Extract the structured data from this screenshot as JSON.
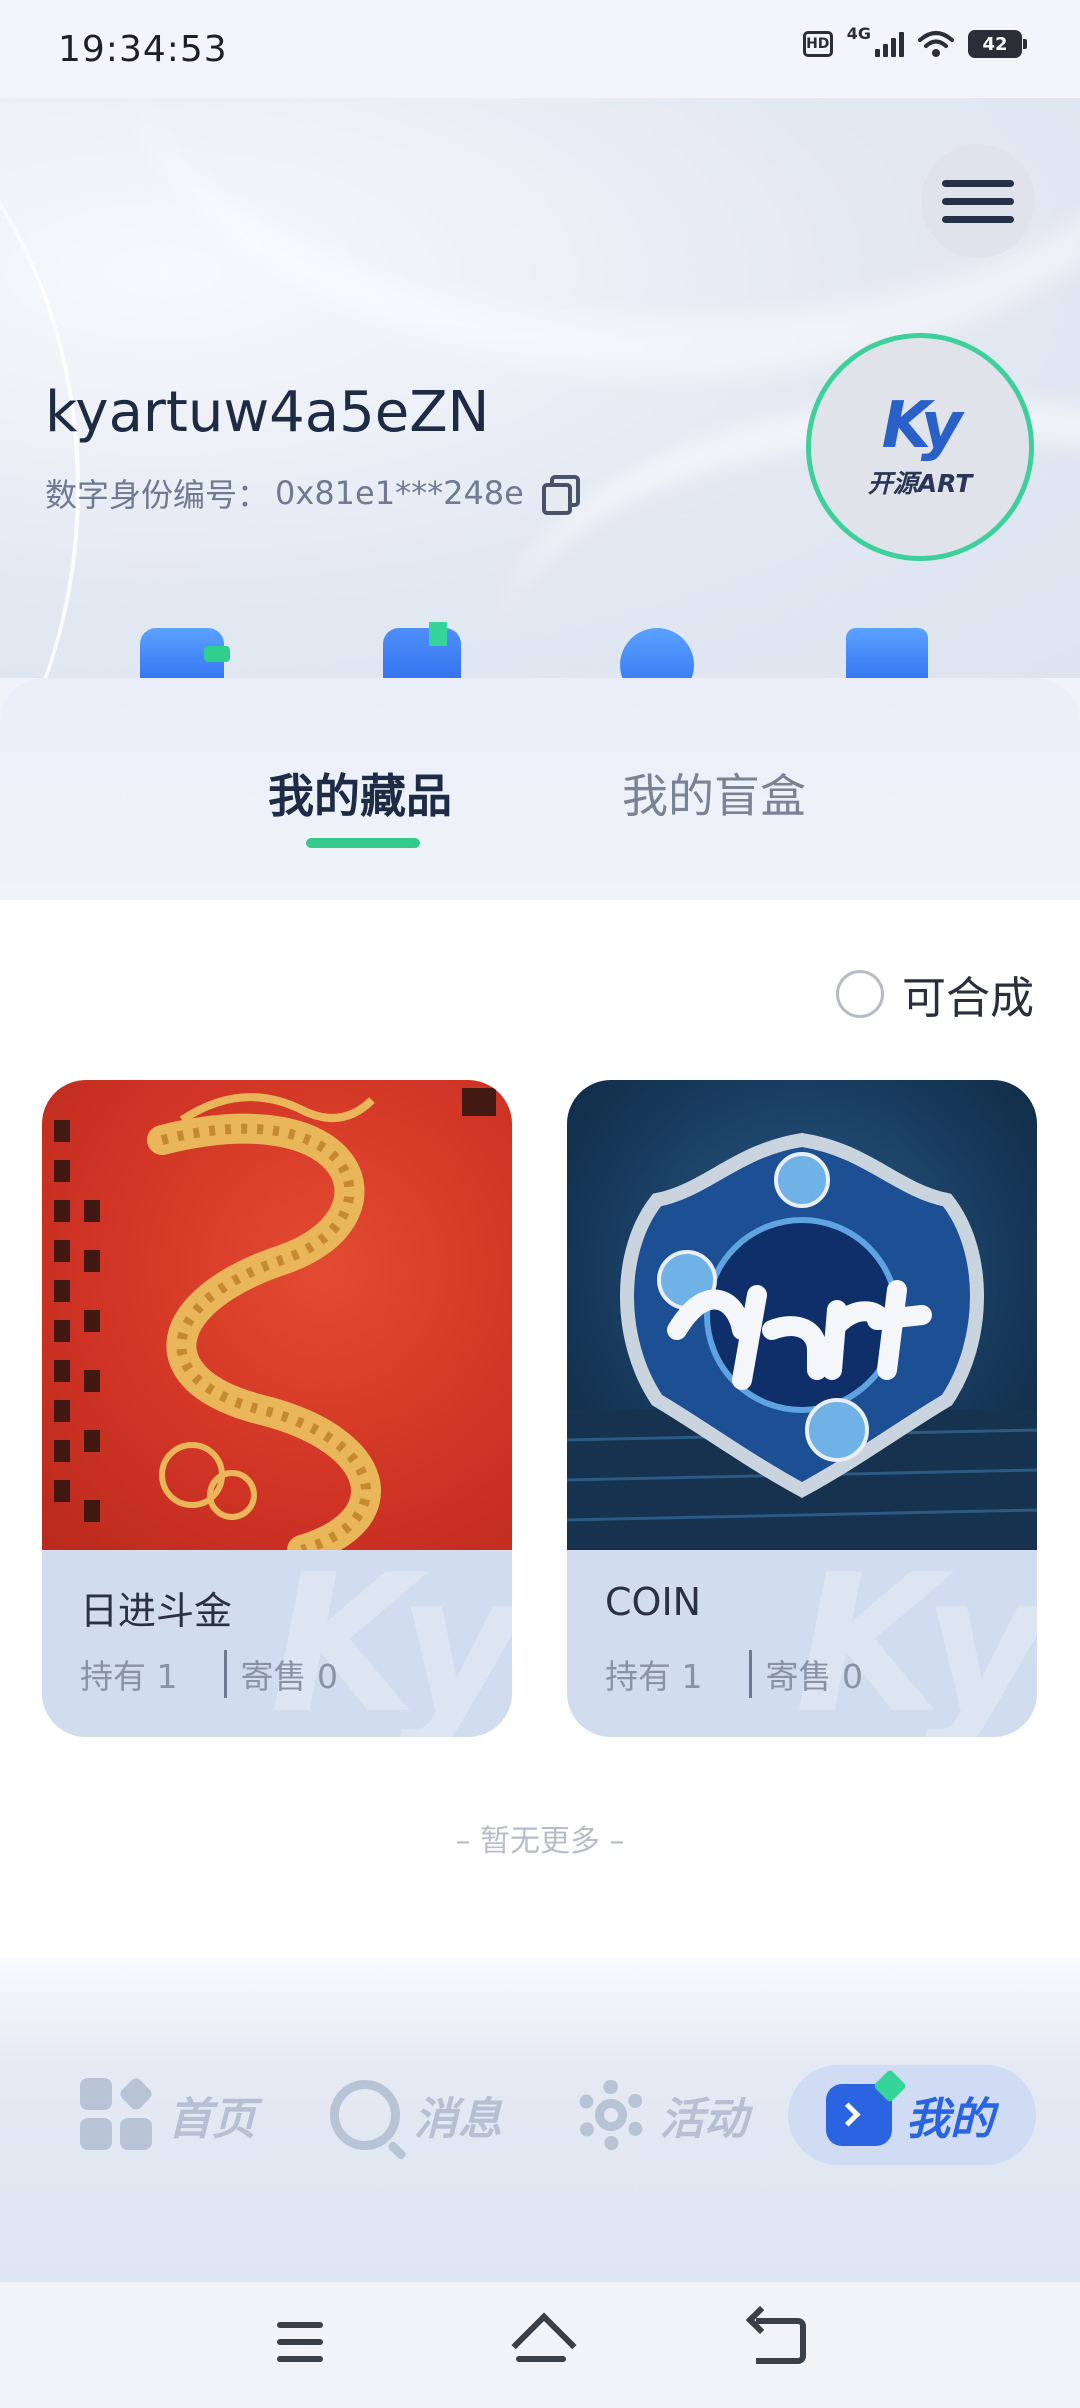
{
  "status_bar": {
    "time": "19:34:53",
    "hd_label": "HD",
    "network_label": "4G",
    "battery_level": "42"
  },
  "profile": {
    "username": "kyartuw4a5eZN",
    "did_label": "数字身份编号：",
    "did_value": "0x81e1***248e",
    "avatar_logo": "Ky",
    "avatar_sub": "开源ART"
  },
  "tabs": [
    {
      "label": "我的藏品",
      "active": true
    },
    {
      "label": "我的盲盒",
      "active": false
    }
  ],
  "filter": {
    "label": "可合成",
    "checked": false
  },
  "collections": [
    {
      "name": "日进斗金",
      "held_label": "持有 1",
      "consign_label": "寄售 0"
    },
    {
      "name": "COIN",
      "held_label": "持有 1",
      "consign_label": "寄售 0"
    }
  ],
  "no_more_text": "– 暂无更多 –",
  "nav": [
    {
      "label": "首页",
      "icon": "grid-icon"
    },
    {
      "label": "消息",
      "icon": "message-icon"
    },
    {
      "label": "活动",
      "icon": "gear-icon"
    },
    {
      "label": "我的",
      "icon": "profile-icon",
      "active": true
    }
  ],
  "colors": {
    "accent_green": "#36c98d",
    "active_blue": "#2a64e0",
    "title_dark": "#1f2a44"
  }
}
